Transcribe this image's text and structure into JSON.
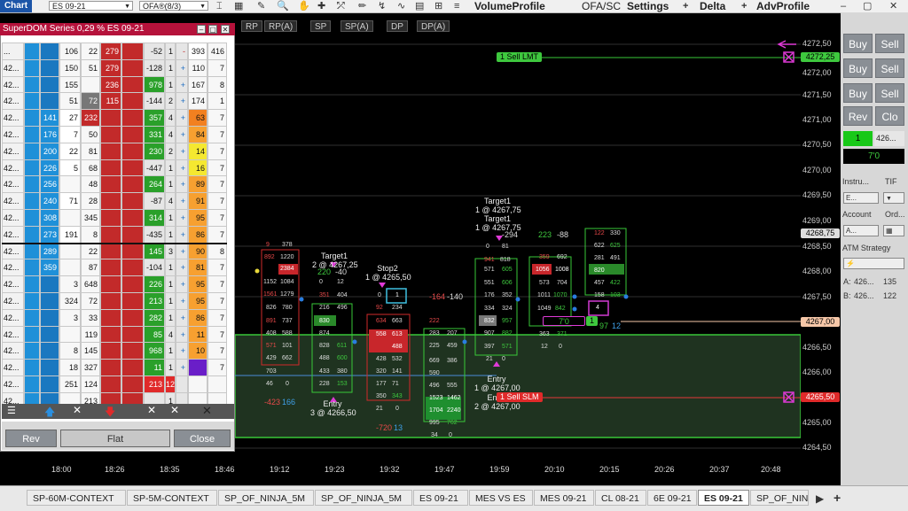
{
  "toolbar": {
    "chart_label": "Chart",
    "instrument": "ES 09-21",
    "indicator": "OFA®(8/3)",
    "volume_profile": "VolumeProfile",
    "ofa_sc": "OFA/SC",
    "settings": "Settings",
    "delta": "Delta",
    "adv_profile": "AdvProfile"
  },
  "chart_tabs": [
    "RP",
    "RP(A)",
    "SP",
    "SP(A)",
    "DP",
    "DP(A)"
  ],
  "dom": {
    "title": "SuperDOM Series 0,29 % ES 09-21",
    "first_price": "...",
    "price_prefix": "42...",
    "rows": [
      {
        "bid": "",
        "bidv": "106",
        "ask": "22",
        "askv": "279",
        "pnl": "-52",
        "qty": "1",
        "side": "-",
        "v1": "393",
        "v2": "416"
      },
      {
        "bid": "",
        "bidv": "150",
        "ask": "51",
        "askv": "279",
        "pnl": "-128",
        "qty": "1",
        "side": "+",
        "v1": "110",
        "v2": "7"
      },
      {
        "bid": "",
        "bidv": "155",
        "ask": "",
        "askv": "236",
        "pnl": "978",
        "qty": "1",
        "side": "+",
        "v1": "167",
        "v2": "8"
      },
      {
        "bid": "",
        "bidv": "51",
        "ask": "72",
        "askv": "115",
        "pnl": "-144",
        "qty": "2",
        "side": "+",
        "v1": "174",
        "v2": "1"
      },
      {
        "bid": "141",
        "bidv": "27",
        "ask": "232",
        "askv": "",
        "pnl": "357",
        "qty": "4",
        "side": "+",
        "v1": "63",
        "v2": "7"
      },
      {
        "bid": "176",
        "bidv": "7",
        "ask": "50",
        "askv": "",
        "pnl": "331",
        "qty": "4",
        "side": "+",
        "v1": "84",
        "v2": "7"
      },
      {
        "bid": "200",
        "bidv": "22",
        "ask": "81",
        "askv": "",
        "pnl": "230",
        "qty": "2",
        "side": "+",
        "v1": "14",
        "v2": "7"
      },
      {
        "bid": "226",
        "bidv": "5",
        "ask": "68",
        "askv": "",
        "pnl": "-447",
        "qty": "1",
        "side": "+",
        "v1": "16",
        "v2": "7"
      },
      {
        "bid": "256",
        "bidv": "",
        "ask": "48",
        "askv": "",
        "pnl": "264",
        "qty": "1",
        "side": "+",
        "v1": "89",
        "v2": "7"
      },
      {
        "bid": "240",
        "bidv": "71",
        "ask": "28",
        "askv": "",
        "pnl": "-87",
        "qty": "4",
        "side": "+",
        "v1": "91",
        "v2": "7"
      },
      {
        "bid": "308",
        "bidv": "",
        "ask": "345",
        "askv": "",
        "pnl": "314",
        "qty": "1",
        "side": "+",
        "v1": "95",
        "v2": "7"
      },
      {
        "bid": "273",
        "bidv": "191",
        "ask": "8",
        "askv": "",
        "pnl": "-435",
        "qty": "1",
        "side": "+",
        "v1": "86",
        "v2": "7"
      },
      {
        "bid": "289",
        "bidv": "",
        "ask": "22",
        "askv": "",
        "pnl": "145",
        "qty": "3",
        "side": "+",
        "v1": "90",
        "v2": "8"
      },
      {
        "bid": "359",
        "bidv": "",
        "ask": "87",
        "askv": "",
        "pnl": "-104",
        "qty": "1",
        "side": "+",
        "v1": "81",
        "v2": "7"
      },
      {
        "bid": "",
        "bidv": "3",
        "ask": "648",
        "askv": "",
        "pnl": "226",
        "qty": "1",
        "side": "+",
        "v1": "95",
        "v2": "7"
      },
      {
        "bid": "",
        "bidv": "324",
        "ask": "72",
        "askv": "",
        "pnl": "213",
        "qty": "1",
        "side": "+",
        "v1": "95",
        "v2": "7"
      },
      {
        "bid": "",
        "bidv": "3",
        "ask": "33",
        "askv": "",
        "pnl": "282",
        "qty": "1",
        "side": "+",
        "v1": "86",
        "v2": "7"
      },
      {
        "bid": "",
        "bidv": "",
        "ask": "119",
        "askv": "",
        "pnl": "85",
        "qty": "4",
        "side": "+",
        "v1": "11",
        "v2": "7"
      },
      {
        "bid": "",
        "bidv": "8",
        "ask": "145",
        "askv": "",
        "pnl": "968",
        "qty": "1",
        "side": "+",
        "v1": "10",
        "v2": "7"
      },
      {
        "bid": "",
        "bidv": "18",
        "ask": "327",
        "askv": "",
        "pnl": "11",
        "qty": "1",
        "side": "+",
        "v1": "",
        "v2": "7"
      },
      {
        "bid": "",
        "bidv": "251",
        "ask": "124",
        "askv": "",
        "pnl": "213",
        "qty": "12",
        "side": "",
        "v1": "",
        "v2": ""
      },
      {
        "bid": "",
        "bidv": "",
        "ask": "213",
        "askv": "",
        "pnl": "",
        "qty": "1",
        "side": "",
        "v1": "",
        "v2": ""
      }
    ],
    "rev_label": "Rev",
    "flat_label": "Flat",
    "close_label": "Close"
  },
  "price_axis": [
    "4272,50",
    "4272,25",
    "4272,00",
    "4271,50",
    "4271,00",
    "4270,50",
    "4270,00",
    "4269,50",
    "4269,00",
    "4268,75",
    "4268,50",
    "4268,00",
    "4267,50",
    "4267,00",
    "4266,50",
    "4266,00",
    "4265,50",
    "4265,00",
    "4264,50"
  ],
  "price_tags": {
    "sell_lmt": "4272,25",
    "last": "4268,75",
    "entry": "4267,00",
    "stop": "4265,50"
  },
  "time_axis": [
    "18:00",
    "18:26",
    "18:35",
    "18:46",
    "19:12",
    "19:23",
    "19:32",
    "19:47",
    "19:59",
    "20:10",
    "20:15",
    "20:26",
    "20:37",
    "20:48"
  ],
  "orders": {
    "sell_lmt": "1  Sell LMT",
    "sell_slm": "1  Sell SLM",
    "position_qty": "1",
    "position_pnl": "7'0"
  },
  "annotations": {
    "target1_a": "Target1",
    "target1_a_sub": "2 @ 4267,25",
    "stop2": "Stop2",
    "stop2_sub": "1 @ 4265,50",
    "target1_b": "Target1",
    "target1_b_sub": "1 @ 4267,75",
    "target1_c": "Target1",
    "target1_c_sub": "1 @ 4267,75",
    "entry_a": "Entry",
    "entry_a_sub": "3 @ 4266,50",
    "entry_b": "Entry",
    "entry_b_sub": "1 @ 4267,00",
    "entry_c": "Entry",
    "entry_c_sub": "2 @ 4267,00"
  },
  "deltas": {
    "d1": "220",
    "d1b": "-40",
    "d2": "-164",
    "d2b": "-140",
    "d3": "-294",
    "d4": "223",
    "d4b": "-88",
    "d5": "-423",
    "d5b": "166",
    "d6": "-720",
    "d6b": "13",
    "d7": "97",
    "d7b": "12"
  },
  "right_panel": {
    "buy": "Buy",
    "sell": "Sell",
    "rev": "Rev",
    "close": "Clo",
    "pos_qty": "1",
    "pos_price": "426...",
    "pnl": "7'0",
    "instrument_label": "Instru...",
    "tif_label": "TIF",
    "instrument_val": "E...",
    "account_label": "Account",
    "order_label": "Ord...",
    "account_val": "A...",
    "atm_label": "ATM Strategy",
    "ask_label": "A:",
    "ask_price": "426...",
    "ask_size": "135",
    "bid_label": "B:",
    "bid_price": "426...",
    "bid_size": "122"
  },
  "bottom_tabs": [
    "SP-60M-CONTEXT",
    "SP-5M-CONTEXT",
    "SP_OF_NINJA_5M",
    "SP_OF_NINJA_5M",
    "ES 09-21",
    "MES VS ES",
    "MES 09-21",
    "CL 08-21",
    "6E 09-21",
    "ES 09-21",
    "SP_OF_NINJA"
  ],
  "active_tab_index": 9,
  "colors": {
    "title": "#b5123b",
    "buy": "#1a8cd8",
    "sell": "#c0282d",
    "green": "#3ec83e",
    "chart_bg": "#000000"
  }
}
